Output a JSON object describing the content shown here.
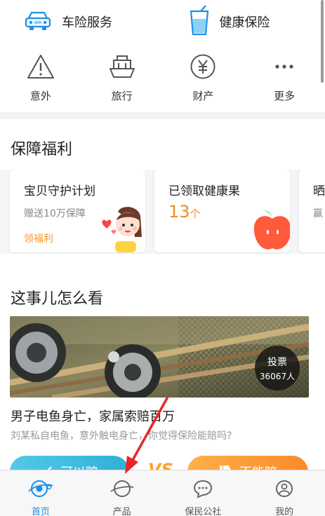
{
  "services": [
    {
      "label": "车险服务",
      "icon": "car-icon"
    },
    {
      "label": "健康保险",
      "icon": "drink-cup-icon"
    }
  ],
  "insurance": [
    {
      "label": "意外",
      "icon": "warning-triangle-icon"
    },
    {
      "label": "旅行",
      "icon": "ship-icon"
    },
    {
      "label": "财产",
      "icon": "yen-circle-icon"
    },
    {
      "label": "更多",
      "icon": "more-dots-icon"
    }
  ],
  "benefits": {
    "title": "保障福利",
    "cards": [
      {
        "title": "宝贝守护计划",
        "subtitle": "赠送10万保障",
        "link": "领福利"
      },
      {
        "title": "已领取健康果",
        "count": "13",
        "unit": "个"
      },
      {
        "title": "晒",
        "subtitle": "赢"
      }
    ]
  },
  "discussion": {
    "title": "这事儿怎么看",
    "vote_label": "投票",
    "vote_count": "36067人",
    "article_title": "男子电鱼身亡，家属索赔百万",
    "article_desc": "刘某私自电鱼，意外触电身亡，你觉得保险能赔吗?",
    "yes_label": "可以赔",
    "vs": "VS",
    "no_label": "不能赔"
  },
  "tabbar": [
    {
      "label": "首页",
      "icon": "home-planet-icon",
      "active": true
    },
    {
      "label": "产品",
      "icon": "product-planet-icon"
    },
    {
      "label": "保民公社",
      "icon": "chat-bubble-icon"
    },
    {
      "label": "我的",
      "icon": "user-icon"
    }
  ],
  "colors": {
    "accent": "#1a8ee8",
    "orange": "#f5891f",
    "yes_btn": "#3dbbe0",
    "no_btn": "#fb9530",
    "annotation_arrow": "#e8262b"
  }
}
